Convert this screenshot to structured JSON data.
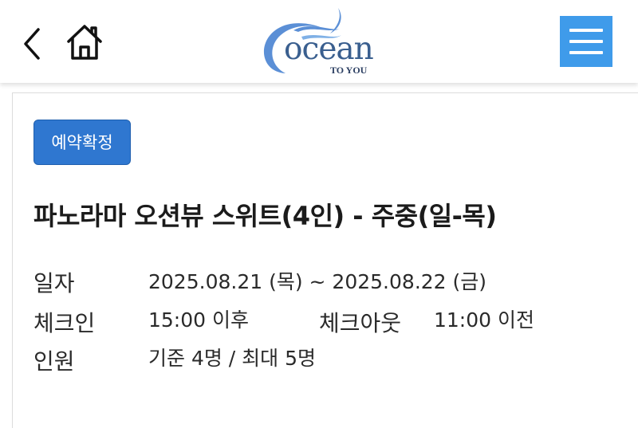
{
  "header": {
    "logo": {
      "text": "ocean",
      "subtext": "TO YOU"
    }
  },
  "reservation": {
    "status_badge": "예약확정",
    "room_title": "파노라마 오션뷰 스위트(4인) - 주중(일-목)",
    "date_label": "일자",
    "date_value": "2025.08.21 (목) ~ 2025.08.22 (금)",
    "checkin_label": "체크인",
    "checkin_value": "15:00 이후",
    "checkout_label": "체크아웃",
    "checkout_value": "11:00 이전",
    "guests_label": "인원",
    "guests_value": "기준 4명 / 최대 5명"
  },
  "colors": {
    "menu_button": "#3f9bea",
    "badge": "#2f77d0",
    "logo_wave": "#5b8fd6",
    "logo_text": "#3a5f8f"
  },
  "icons": {
    "back": "chevron-left-icon",
    "home": "home-icon",
    "menu": "hamburger-menu-icon"
  }
}
